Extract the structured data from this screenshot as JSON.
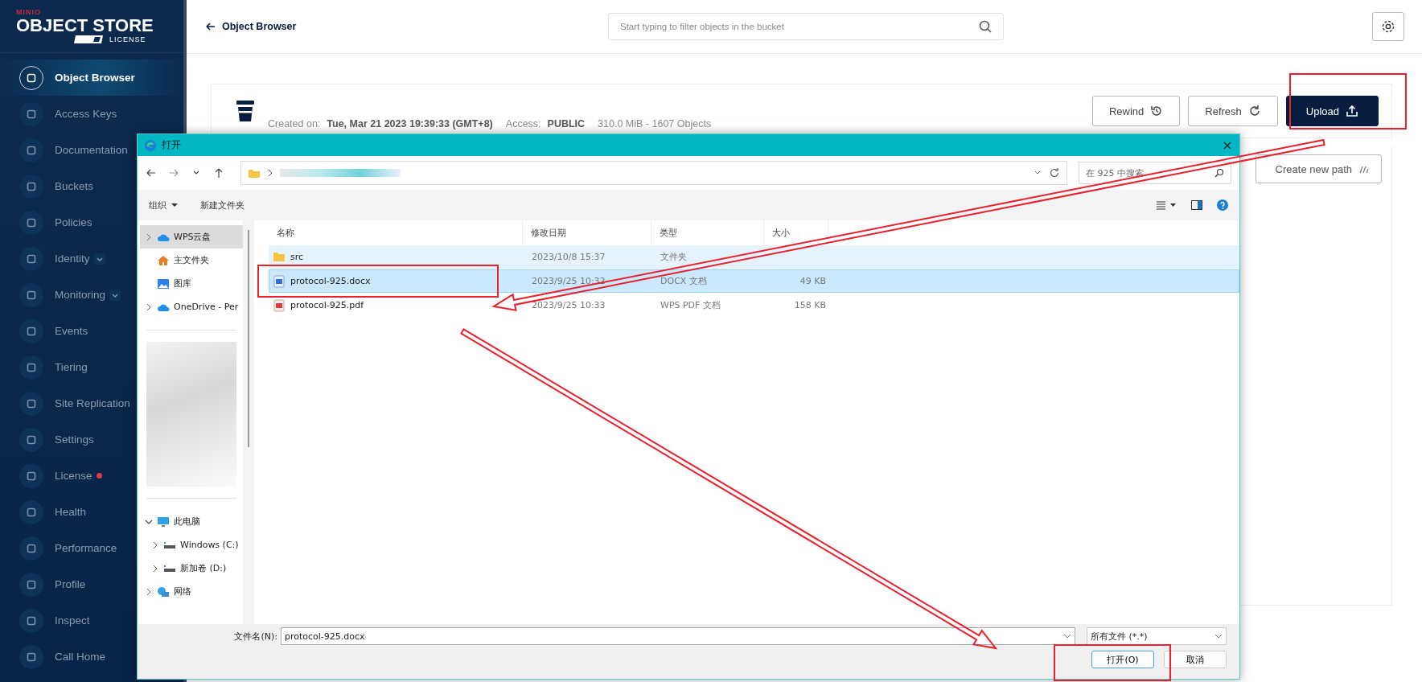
{
  "sidebar": {
    "brand": "MINIO",
    "product": "OBJECT STORE",
    "license": "LICENSE",
    "items": [
      {
        "label": "Object Browser",
        "selected": true,
        "expandable": false,
        "alert": false
      },
      {
        "label": "Access Keys",
        "selected": false,
        "expandable": false,
        "alert": false
      },
      {
        "label": "Documentation",
        "selected": false,
        "expandable": false,
        "alert": false
      },
      {
        "label": "Buckets",
        "selected": false,
        "expandable": false,
        "alert": false
      },
      {
        "label": "Policies",
        "selected": false,
        "expandable": false,
        "alert": false
      },
      {
        "label": "Identity",
        "selected": false,
        "expandable": true,
        "alert": false
      },
      {
        "label": "Monitoring",
        "selected": false,
        "expandable": true,
        "alert": false
      },
      {
        "label": "Events",
        "selected": false,
        "expandable": false,
        "alert": false
      },
      {
        "label": "Tiering",
        "selected": false,
        "expandable": false,
        "alert": false
      },
      {
        "label": "Site Replication",
        "selected": false,
        "expandable": false,
        "alert": false
      },
      {
        "label": "Settings",
        "selected": false,
        "expandable": false,
        "alert": false
      },
      {
        "label": "License",
        "selected": false,
        "expandable": false,
        "alert": true
      },
      {
        "label": "Health",
        "selected": false,
        "expandable": false,
        "alert": false
      },
      {
        "label": "Performance",
        "selected": false,
        "expandable": false,
        "alert": false
      },
      {
        "label": "Profile",
        "selected": false,
        "expandable": false,
        "alert": false
      },
      {
        "label": "Inspect",
        "selected": false,
        "expandable": false,
        "alert": false
      },
      {
        "label": "Call Home",
        "selected": false,
        "expandable": false,
        "alert": false
      }
    ]
  },
  "header": {
    "back_label": "Object Browser",
    "search": {
      "placeholder": "Start typing to filter objects in the bucket"
    }
  },
  "bucket": {
    "created_label": "Created on:",
    "created": "Tue, Mar 21 2023 19:39:33 (GMT+8)",
    "access_label": "Access:",
    "access": "PUBLIC",
    "usage": "310.0 MiB - 1607 Objects",
    "buttons": [
      {
        "label": "Rewind",
        "kind": "rewind"
      },
      {
        "label": "Refresh",
        "kind": "refresh"
      },
      {
        "label": "Upload",
        "kind": "upload"
      }
    ]
  },
  "create_path_button": "Create new path",
  "dialog": {
    "title": "打开",
    "search": {
      "placeholder": "在 925 中搜索"
    },
    "toolbar": [
      {
        "label": "组织",
        "kind": "menu"
      },
      {
        "label": "新建文件夹",
        "kind": "button"
      }
    ],
    "nav_top": [
      {
        "label": "WPS云盘",
        "kind": "cloud",
        "selected": true,
        "expandable": true,
        "expanded": false
      },
      {
        "label": "主文件夹",
        "kind": "home",
        "selected": false,
        "expandable": false
      },
      {
        "label": "图库",
        "kind": "gallery",
        "selected": false,
        "expandable": false
      },
      {
        "label": "OneDrive - Per",
        "kind": "cloud",
        "selected": false,
        "expandable": true,
        "expanded": false
      }
    ],
    "nav_bottom": [
      {
        "label": "此电脑",
        "kind": "pc",
        "selected": false,
        "expandable": true,
        "expanded": true,
        "children": [
          {
            "label": "Windows (C:)",
            "kind": "drive",
            "selected": false,
            "expandable": true,
            "expanded": false
          },
          {
            "label": "新加卷 (D:)",
            "kind": "drive",
            "selected": false,
            "expandable": true,
            "expanded": false
          }
        ]
      },
      {
        "label": "网络",
        "kind": "network",
        "selected": false,
        "expandable": true,
        "expanded": false
      }
    ],
    "columns": [
      "名称",
      "修改日期",
      "类型",
      "大小"
    ],
    "rows": [
      {
        "name": "src",
        "date": "2023/10/8 15:37",
        "type": "文件夹",
        "kind": "folder",
        "selected": false,
        "hovered": true
      },
      {
        "name": "protocol-925.docx",
        "date": "2023/9/25 10:32",
        "type": "DOCX 文档",
        "size": "49 KB",
        "kind": "docx",
        "selected": true,
        "hovered": false
      },
      {
        "name": "protocol-925.pdf",
        "date": "2023/9/25 10:33",
        "type": "WPS PDF 文档",
        "size": "158 KB",
        "kind": "pdf",
        "selected": false,
        "hovered": false
      }
    ],
    "filename_label": "文件名(N):",
    "filename": "protocol-925.docx",
    "filetype": "所有文件 (*.*)",
    "buttons": [
      {
        "label": "打开(O)",
        "kind": "primary"
      },
      {
        "label": "取消",
        "kind": "secondary"
      }
    ]
  }
}
